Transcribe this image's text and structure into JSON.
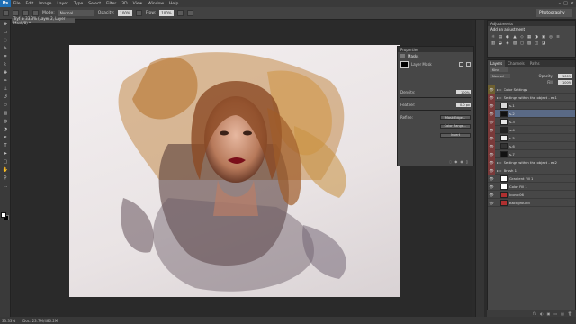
{
  "app": {
    "logo": "Ps"
  },
  "menu": [
    "File",
    "Edit",
    "Image",
    "Layer",
    "Type",
    "Select",
    "Filter",
    "3D",
    "View",
    "Window",
    "Help"
  ],
  "window_controls": [
    "–",
    "□",
    "×"
  ],
  "options": {
    "mode_label": "Mode:",
    "mode_value": "Normal",
    "opacity_label": "Opacity:",
    "opacity_value": "100%",
    "flow_label": "Flow:",
    "flow_value": "100%",
    "workspace": "Photography"
  },
  "document": {
    "tab": "Tryf ⊗ 33.3% (Layer 2, Layer Mask/8) *"
  },
  "status": {
    "zoom": "33.33%",
    "doc": "Doc: 23.7M/486.2M"
  },
  "properties": {
    "tab": "Properties",
    "title": "Masks",
    "mask_type": "Layer Mask",
    "density_label": "Density:",
    "density_value": "100%",
    "feather_label": "Feather:",
    "feather_value": "0.0 px",
    "refine_label": "Refine:",
    "btn_mask_edge": "Mask Edge...",
    "btn_color_range": "Color Range...",
    "btn_invert": "Invert"
  },
  "adjustments": {
    "tab": "Adjustments",
    "title": "Add an adjustment",
    "icons": [
      "☼",
      "▤",
      "◐",
      "▲",
      "◇",
      "▦",
      "◑",
      "▣",
      "◎",
      "≡",
      "▥",
      "◒",
      "◈",
      "▧",
      "◻",
      "▨",
      "◫",
      "◪"
    ]
  },
  "layers": {
    "tabs": [
      "Layers",
      "Channels",
      "Paths"
    ],
    "filter": "Kind",
    "blend": "Normal",
    "opacity_label": "Opacity:",
    "opacity_value": "100%",
    "fill_label": "Fill:",
    "fill_value": "100%",
    "rows": [
      {
        "name": "Color Settings",
        "kind": "folder",
        "eye": "yel"
      },
      {
        "name": "Settings within the object - ex1",
        "kind": "folder",
        "eye": "red"
      },
      {
        "name": "s-1",
        "kind": "layer",
        "eye": "red",
        "thumb": "#d9d9d9"
      },
      {
        "name": "s-2",
        "kind": "layer",
        "eye": "red",
        "thumb": "#111111",
        "sel": true
      },
      {
        "name": "s-3",
        "kind": "layer",
        "eye": "red",
        "thumb": "#e6e6e6"
      },
      {
        "name": "s-4",
        "kind": "layer",
        "eye": "red",
        "thumb": "#222222"
      },
      {
        "name": "s-5",
        "kind": "layer",
        "eye": "red",
        "thumb": "#eeeeee"
      },
      {
        "name": "s-6",
        "kind": "layer",
        "eye": "red",
        "thumb": "#333333"
      },
      {
        "name": "s-7",
        "kind": "layer",
        "eye": "red",
        "thumb": "#111111"
      },
      {
        "name": "Settings within the object - ex2",
        "kind": "folder",
        "eye": "red"
      },
      {
        "name": "Brush 1",
        "kind": "folder",
        "eye": "red"
      },
      {
        "name": "Gradient Fill 1",
        "kind": "layer",
        "eye": "none",
        "thumb": "#ffffff"
      },
      {
        "name": "Color Fill 1",
        "kind": "layer",
        "eye": "none",
        "thumb": "#ffffff"
      },
      {
        "name": "Iconic06",
        "kind": "layer",
        "eye": "none",
        "thumb": "#b03030"
      },
      {
        "name": "Background",
        "kind": "layer",
        "eye": "none",
        "thumb": "#b03030"
      }
    ],
    "footer_icons": [
      "fx",
      "◐",
      "▣",
      "▭",
      "▤",
      "🗑"
    ]
  },
  "colors": {
    "accent": "#1f6fb5",
    "selected_row": "#5a6a86"
  }
}
